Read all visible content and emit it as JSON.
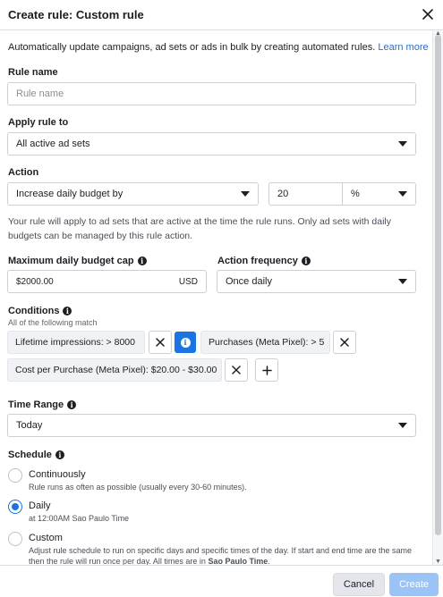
{
  "dialog": {
    "title": "Create rule: Custom rule",
    "close_icon": "close-icon"
  },
  "intro": {
    "text": "Automatically update campaigns, ad sets or ads in bulk by creating automated rules.",
    "link": "Learn more"
  },
  "rule_name": {
    "label": "Rule name",
    "placeholder": "Rule name",
    "value": ""
  },
  "apply_rule_to": {
    "label": "Apply rule to",
    "value": "All active ad sets"
  },
  "action": {
    "label": "Action",
    "value": "Increase daily budget by",
    "amount": "20",
    "unit": "%"
  },
  "hint": {
    "line1": "Your rule will apply to ad sets that are active at the time the rule runs. Only ad sets with daily",
    "line2": "budgets can be managed by this rule action."
  },
  "max_budget_cap": {
    "label": "Maximum daily budget cap",
    "value": "$2000.00",
    "currency": "USD"
  },
  "action_frequency": {
    "label": "Action frequency",
    "value": "Once daily"
  },
  "conditions": {
    "label": "Conditions",
    "sublabel": "All of the following match",
    "items": [
      {
        "name": "Lifetime impressions:",
        "operator": ">",
        "value": "8000"
      },
      {
        "name": "Purchases (Meta Pixel):",
        "operator": ">",
        "value": "5"
      },
      {
        "name": "Cost per Purchase (Meta Pixel):",
        "operator": "",
        "value": "$20.00 - $30.00"
      }
    ],
    "add_icon": "plus-icon"
  },
  "time_range": {
    "label": "Time Range",
    "value": "Today"
  },
  "schedule": {
    "label": "Schedule",
    "options": [
      {
        "label": "Continuously",
        "desc": "Rule runs as often as possible (usually every 30-60 minutes).",
        "checked": false
      },
      {
        "label": "Daily",
        "desc": "at 12:00AM Sao Paulo Time",
        "checked": true
      },
      {
        "label": "Custom",
        "desc1": "Adjust rule schedule to run on specific days and specific times of the day. If start and end time are the same",
        "desc2_pre": "then the rule will run once per day. All times are in ",
        "desc2_bold": "Sao Paulo Time",
        "desc2_post": ".",
        "checked": false
      }
    ]
  },
  "footer": {
    "cancel": "Cancel",
    "create": "Create"
  },
  "colors": {
    "accent": "#1b74e4",
    "link": "#216fdb",
    "create_disabled": "#9cc3f5"
  }
}
